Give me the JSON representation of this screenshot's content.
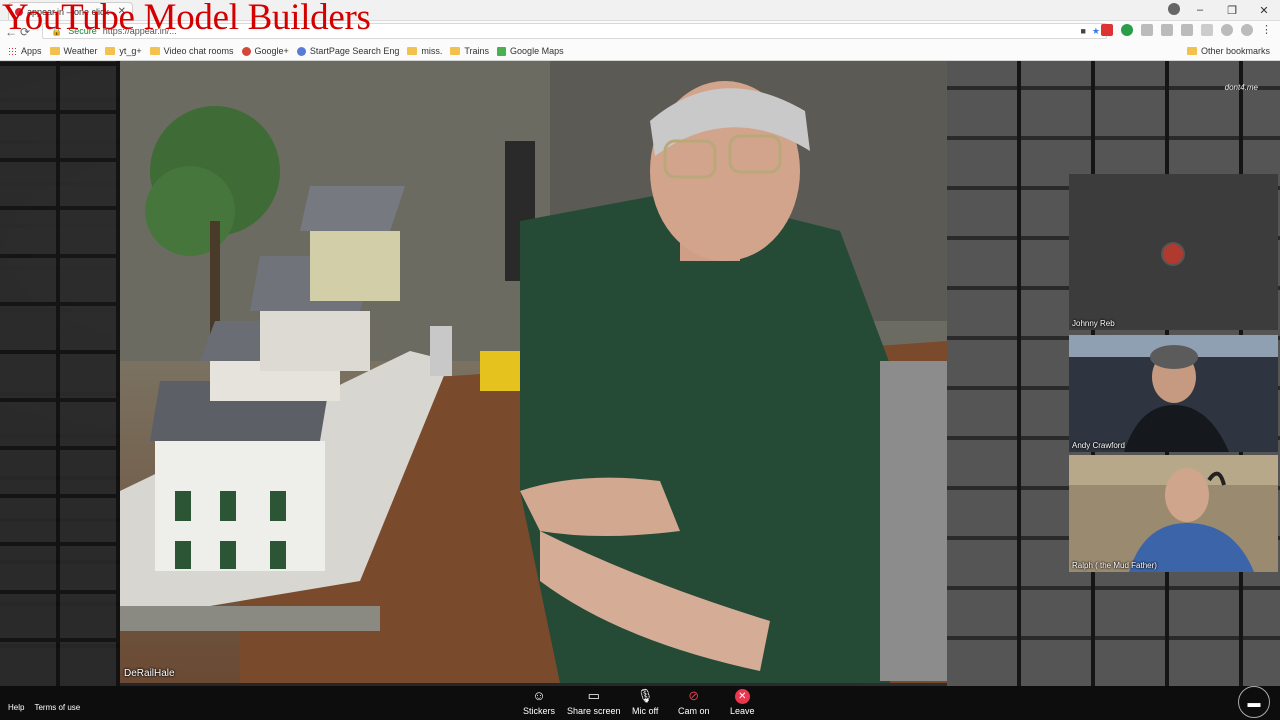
{
  "overlay": {
    "title": "YouTube Model Builders"
  },
  "browser": {
    "tab_title": "appear.in – one click",
    "address_secure": "Secure",
    "address_url": "https://appear.in/...",
    "window_controls": {
      "minimize": "–",
      "restore": "❐",
      "close": "✕"
    }
  },
  "bookmarks": {
    "items": [
      {
        "label": "Apps",
        "icon": "apps-icon"
      },
      {
        "label": "Weather",
        "icon": "folder-icon"
      },
      {
        "label": "yt_g+",
        "icon": "folder-icon"
      },
      {
        "label": "Video chat rooms",
        "icon": "folder-icon"
      },
      {
        "label": "Google+",
        "icon": "google-plus-icon"
      },
      {
        "label": "StartPage Search Eng",
        "icon": "startpage-icon"
      },
      {
        "label": "miss.",
        "icon": "folder-icon"
      },
      {
        "label": "Trains",
        "icon": "folder-icon"
      },
      {
        "label": "Google Maps",
        "icon": "maps-icon"
      }
    ],
    "other": "Other bookmarks"
  },
  "room": {
    "watermark": "dont4.me",
    "main_participant": "DeRailHale",
    "participants": [
      {
        "name": "Johnny Reb",
        "video": false
      },
      {
        "name": "Andy Crawford",
        "video": true
      },
      {
        "name": "Ralph ( the Mud Father)",
        "video": true
      }
    ]
  },
  "controls": {
    "stickers": "Stickers",
    "share_screen": "Share screen",
    "mic": "Mic off",
    "cam": "Cam on",
    "leave": "Leave"
  },
  "footer": {
    "help": "Help",
    "terms": "Terms of use"
  },
  "colors": {
    "overlay_title": "#d40000",
    "leave": "#e8384f"
  }
}
